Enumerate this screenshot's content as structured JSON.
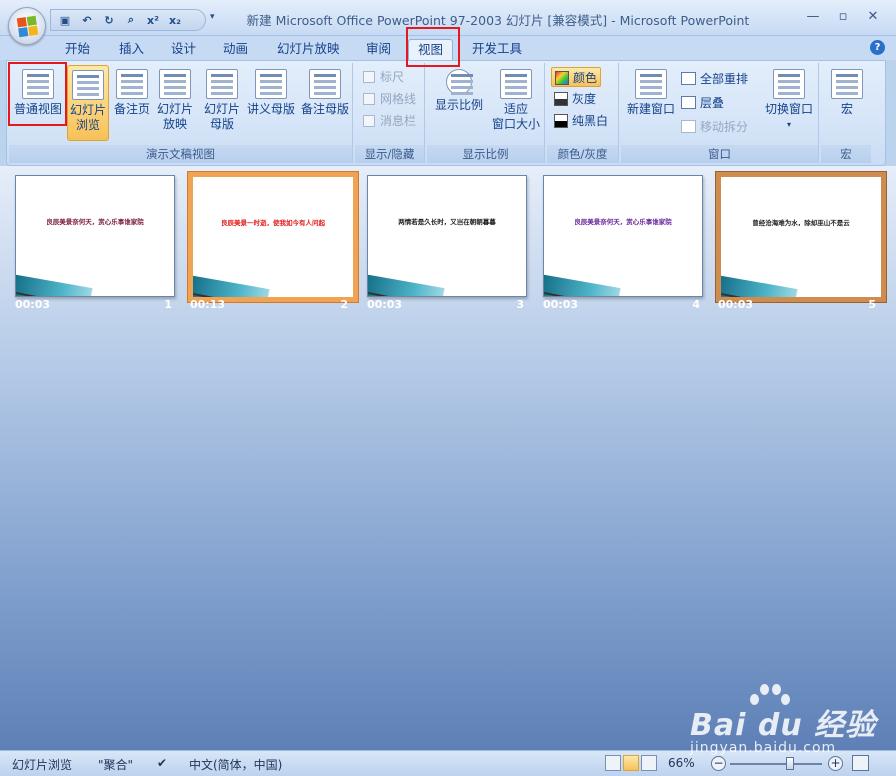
{
  "window": {
    "title": "新建 Microsoft Office PowerPoint 97-2003 幻灯片 [兼容模式] - Microsoft PowerPoint"
  },
  "tabs": [
    "开始",
    "插入",
    "设计",
    "动画",
    "幻灯片放映",
    "审阅",
    "视图",
    "开发工具"
  ],
  "active_tab": "视图",
  "ribbon": {
    "presentation_views": {
      "label": "演示文稿视图",
      "normal": "普通视图",
      "sorter_line1": "幻灯片",
      "sorter_line2": "浏览",
      "notes": "备注页",
      "slideshow_line1": "幻灯片",
      "slideshow_line2": "放映",
      "slide_master_line1": "幻灯片",
      "slide_master_line2": "母版",
      "handout_master": "讲义母版",
      "notes_master": "备注母版"
    },
    "show_hide": {
      "label": "显示/隐藏",
      "ruler": "标尺",
      "gridlines": "网格线",
      "message_bar": "消息栏"
    },
    "zoom": {
      "label": "显示比例",
      "zoom": "显示比例",
      "fit_line1": "适应",
      "fit_line2": "窗口大小"
    },
    "color": {
      "label": "颜色/灰度",
      "color": "颜色",
      "grayscale": "灰度",
      "pure_bw": "纯黑白"
    },
    "window_group": {
      "label": "窗口",
      "new_window": "新建窗口",
      "arrange_all": "全部重排",
      "cascade": "层叠",
      "move_split": "移动拆分",
      "switch_window": "切换窗口"
    },
    "macros": {
      "label": "宏",
      "macros": "宏"
    }
  },
  "slides": [
    {
      "time": "00:03",
      "num": "1",
      "text": "良辰美景奈何天，赏心乐事谁家院",
      "color": "#7a1f3d"
    },
    {
      "time": "00:13",
      "num": "2",
      "text": "良辰美景一时逝，使我如今有人问起",
      "color": "#e21e1e"
    },
    {
      "time": "00:03",
      "num": "3",
      "text": "两情若是久长时，又岂在朝朝暮暮",
      "color": "#222222"
    },
    {
      "time": "00:03",
      "num": "4",
      "text": "良辰美景奈何天，赏心乐事谁家院",
      "color": "#6a2a9a"
    },
    {
      "time": "00:03",
      "num": "5",
      "text": "曾经沧海难为水，除却巫山不是云",
      "color": "#222222"
    }
  ],
  "statusbar": {
    "view": "幻灯片浏览",
    "theme": "\"聚合\"",
    "language": "中文(简体，中国)",
    "zoom": "66%"
  },
  "watermark": {
    "brand": "Bai du 经验",
    "url": "jingyan.baidu.com"
  },
  "colors": {
    "accent_red": "#e3191b",
    "selection_orange": "#f1a354"
  }
}
